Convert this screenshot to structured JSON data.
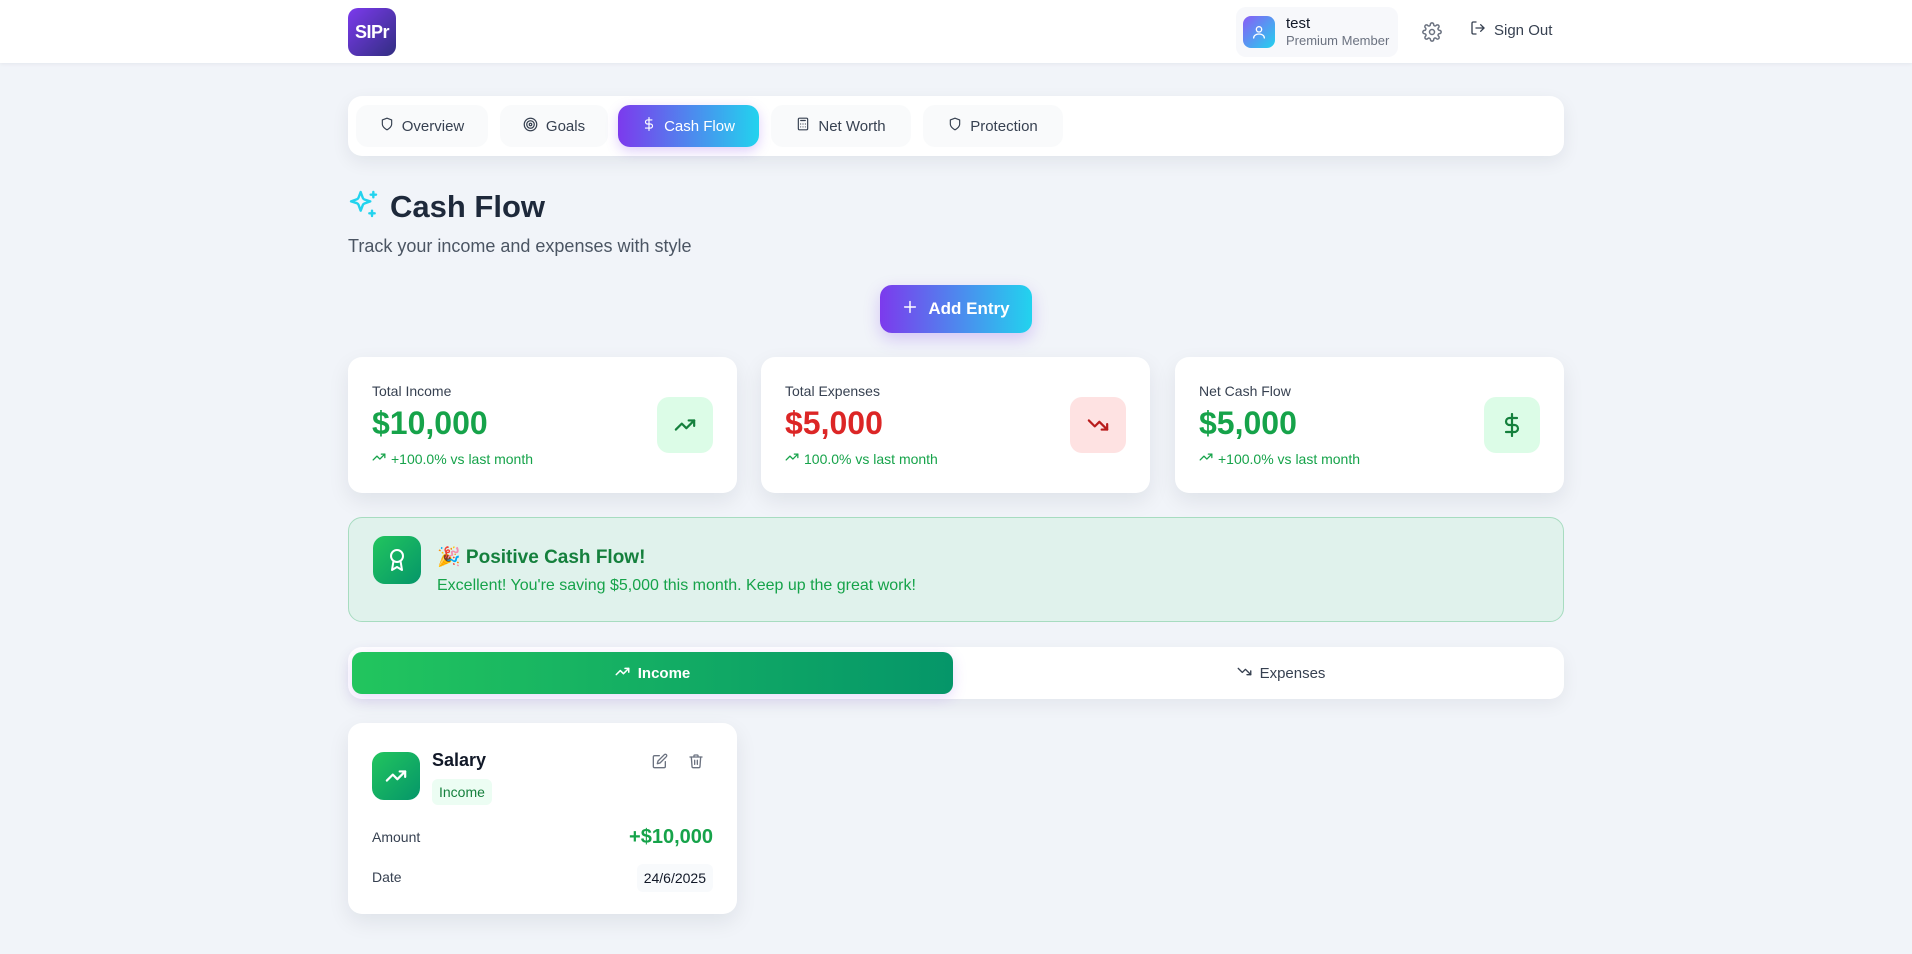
{
  "header": {
    "logo_text": "SIPr",
    "user_name": "test",
    "user_role": "Premium Member",
    "settings_icon": "gear-icon",
    "sign_out_label": "Sign Out"
  },
  "tabs": [
    {
      "label": "Overview",
      "icon": "shield-icon",
      "active": false
    },
    {
      "label": "Goals",
      "icon": "target-icon",
      "active": false
    },
    {
      "label": "Cash Flow",
      "icon": "dollar-icon",
      "active": true
    },
    {
      "label": "Net Worth",
      "icon": "calculator-icon",
      "active": false
    },
    {
      "label": "Protection",
      "icon": "shield-icon",
      "active": false
    }
  ],
  "page": {
    "title": "Cash Flow",
    "subtitle": "Track your income and expenses with style",
    "add_entry_label": "Add Entry"
  },
  "stats": [
    {
      "label": "Total Income",
      "value": "$10,000",
      "trend": "+100.0% vs last month",
      "icon": "trending-up-icon"
    },
    {
      "label": "Total Expenses",
      "value": "$5,000",
      "trend": "100.0% vs last month",
      "icon": "trending-down-icon"
    },
    {
      "label": "Net Cash Flow",
      "value": "$5,000",
      "trend": "+100.0% vs last month",
      "icon": "dollar-icon"
    }
  ],
  "banner": {
    "title": "🎉 Positive Cash Flow!",
    "text": "Excellent! You're saving $5,000 this month. Keep up the great work!",
    "icon": "award-icon"
  },
  "toggle": {
    "income_label": "Income",
    "expenses_label": "Expenses",
    "active": "Income"
  },
  "entries": [
    {
      "name": "Salary",
      "category": "Income",
      "amount_label": "Amount",
      "amount": "+$10,000",
      "date_label": "Date",
      "date": "24/6/2025"
    }
  ],
  "colors": {
    "accent_start": "#7c3aed",
    "accent_end": "#22d3ee",
    "income_green": "#16a34a",
    "expense_red": "#dc2626"
  }
}
